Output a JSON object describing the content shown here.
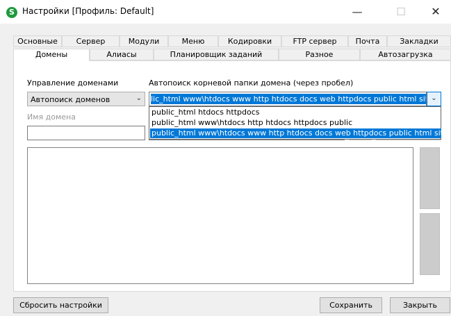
{
  "window": {
    "title": "Настройки [Профиль: Default]",
    "icon_letter": "S",
    "icon_color": "#1e9a3c",
    "minimize_glyph": "—",
    "maximize_glyph": "☐",
    "close_glyph": "✕"
  },
  "tabs_row1": [
    "Основные",
    "Сервер",
    "Модули",
    "Меню",
    "Кодировки",
    "FTP сервер",
    "Почта",
    "Закладки"
  ],
  "tabs_row2": [
    "Домены",
    "Алиасы",
    "Планировщик заданий",
    "Разное",
    "Автозагрузка"
  ],
  "active_tab": "Домены",
  "domains": {
    "management_label": "Управление доменами",
    "management_value": "Автопоиск доменов",
    "autosearch_label": "Автопоиск корневой папки домена (через пробел)",
    "autosearch_value": "lic_html www\\htdocs www http htdocs docs web httpdocs public html site",
    "autosearch_options": [
      "public_html htdocs httpdocs",
      "public_html www\\htdocs http htdocs httpdocs public",
      "public_html www\\htdocs www http htdocs docs web httpdocs public html site"
    ],
    "selected_option_index": 2,
    "domain_name_label": "Имя домена"
  },
  "buttons": {
    "reset": "Сбросить настройки",
    "save": "Сохранить",
    "close": "Закрыть"
  },
  "colors": {
    "accent": "#0078d7",
    "selection_text": "#ffffff"
  }
}
